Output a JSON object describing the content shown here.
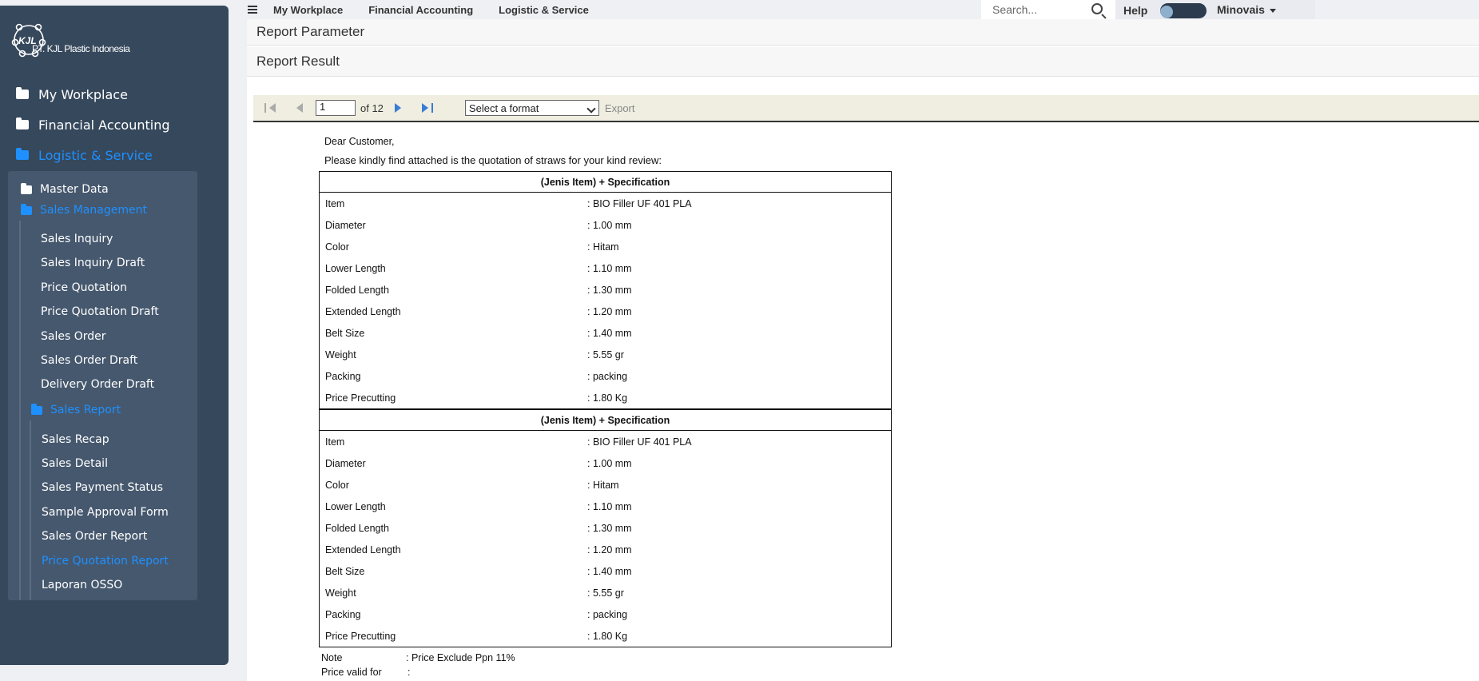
{
  "sidebar": {
    "logo_text": "PT. KJL Plastic Indonesia",
    "top_items": [
      {
        "label": "My Workplace"
      },
      {
        "label": "Financial Accounting"
      },
      {
        "label": "Logistic & Service"
      }
    ],
    "master_data": "Master Data",
    "sales_management": "Sales Management",
    "sales_management_items": [
      "Sales Inquiry",
      "Sales Inquiry Draft",
      "Price Quotation",
      "Price Quotation Draft",
      "Sales Order",
      "Sales Order Draft",
      "Delivery Order Draft"
    ],
    "sales_report": "Sales Report",
    "sales_report_items": [
      "Sales Recap",
      "Sales Detail",
      "Sales Payment Status",
      "Sample Approval Form",
      "Sales Order Report",
      "Price Quotation Report",
      "Laporan OSSO"
    ]
  },
  "topnav": {
    "items": [
      "My Workplace",
      "Financial Accounting",
      "Logistic & Service"
    ],
    "search_placeholder": "Search...",
    "help": "Help",
    "user": "Minovais"
  },
  "main": {
    "report_parameter": "Report Parameter",
    "report_result": "Report Result",
    "toolbar": {
      "page_value": "1",
      "of_label": "of 12",
      "format_placeholder": "Select a format",
      "export_label": "Export"
    },
    "document": {
      "greeting": "Dear Customer,",
      "intro": "Please kindly find attached is the quotation of straws for your kind review:",
      "specs": [
        {
          "header": "(Jenis Item) + Specification",
          "rows": [
            {
              "label": "Item",
              "value": ":  BIO Filler UF 401 PLA"
            },
            {
              "label": "Diameter",
              "value": ": 1.00 mm"
            },
            {
              "label": "Color",
              "value": ": Hitam"
            },
            {
              "label": "Lower Length",
              "value": ": 1.10 mm"
            },
            {
              "label": "Folded Length",
              "value": ": 1.30 mm"
            },
            {
              "label": "Extended Length",
              "value": ": 1.20 mm"
            },
            {
              "label": "Belt Size",
              "value": ": 1.40 mm"
            },
            {
              "label": "Weight",
              "value": ": 5.55 gr"
            },
            {
              "label": "Packing",
              "value": ": packing"
            },
            {
              "label": "Price Precutting",
              "value": ": 1.80 Kg"
            }
          ]
        },
        {
          "header": "(Jenis Item) + Specification",
          "rows": [
            {
              "label": "Item",
              "value": ":  BIO Filler UF 401 PLA"
            },
            {
              "label": "Diameter",
              "value": ": 1.00 mm"
            },
            {
              "label": "Color",
              "value": ": Hitam"
            },
            {
              "label": "Lower Length",
              "value": ": 1.10 mm"
            },
            {
              "label": "Folded Length",
              "value": ": 1.30 mm"
            },
            {
              "label": "Extended Length",
              "value": ": 1.20 mm"
            },
            {
              "label": "Belt Size",
              "value": ": 1.40 mm"
            },
            {
              "label": "Weight",
              "value": ": 5.55 gr"
            },
            {
              "label": "Packing",
              "value": ": packing"
            },
            {
              "label": "Price Precutting",
              "value": ": 1.80 Kg"
            }
          ]
        }
      ],
      "note_label": "Note",
      "note_value": ": Price Exclude Ppn 11%",
      "valid_label": "Price valid for",
      "valid_value": ":"
    }
  },
  "colors": {
    "sidebar_bg": "#36485c",
    "active": "#1e90ff"
  }
}
